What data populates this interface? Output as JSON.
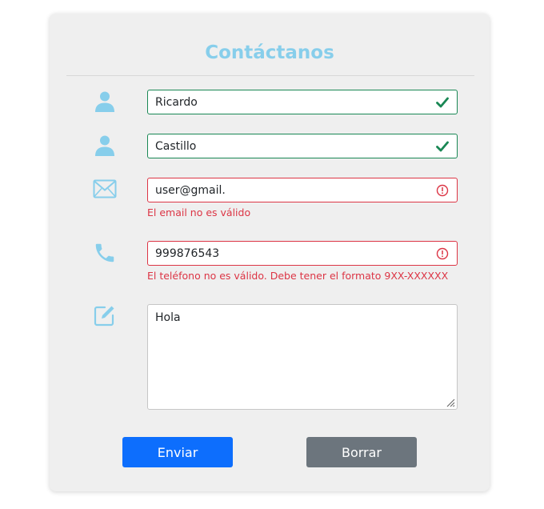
{
  "form": {
    "title": "Contáctanos",
    "fields": {
      "first_name": {
        "value": "Ricardo",
        "status": "valid",
        "icon": "user-icon"
      },
      "last_name": {
        "value": "Castillo",
        "status": "valid",
        "icon": "user-icon"
      },
      "email": {
        "value": "user@gmail.",
        "status": "invalid",
        "icon": "envelope-icon",
        "error": "El email no es válido"
      },
      "phone": {
        "value": "999876543",
        "status": "invalid",
        "icon": "phone-icon",
        "error": "El teléfono no es válido. Debe tener el formato 9XX-XXXXXX"
      },
      "message": {
        "value": "Hola",
        "icon": "pencil-square-icon"
      }
    },
    "buttons": {
      "send": "Enviar",
      "clear": "Borrar"
    }
  },
  "colors": {
    "accent": "#87ceeb",
    "valid": "#198754",
    "invalid": "#dc3545",
    "primary_button": "#0d6efd",
    "secondary_button": "#6c757d"
  }
}
